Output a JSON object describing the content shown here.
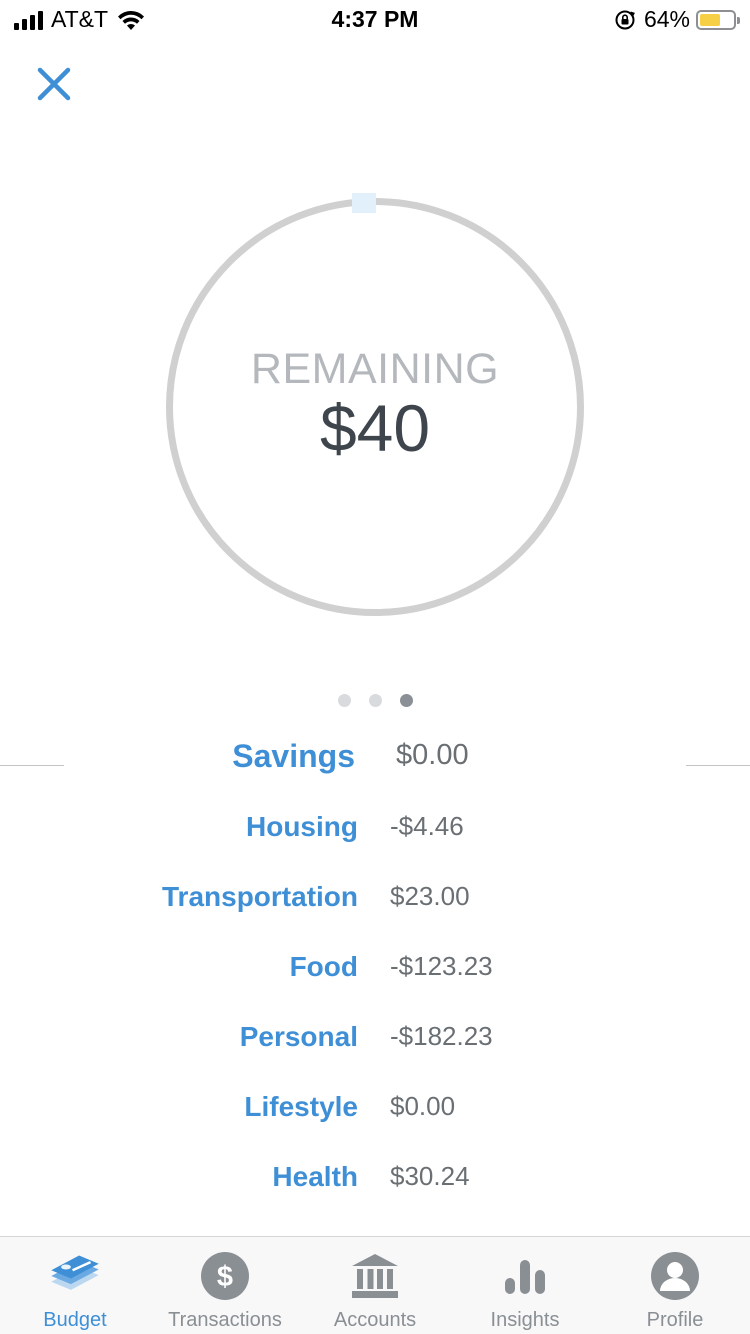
{
  "status_bar": {
    "carrier": "AT&T",
    "time": "4:37 PM",
    "battery_percent": "64%",
    "battery_level": 0.64,
    "battery_color": "#f7cf46"
  },
  "header": {
    "close_icon": "close-icon"
  },
  "summary": {
    "label": "REMAINING",
    "amount": "$40"
  },
  "pager": {
    "count": 3,
    "active_index": 2
  },
  "categories": [
    {
      "name": "Savings",
      "value": "$0.00"
    },
    {
      "name": "Housing",
      "value": "-$4.46"
    },
    {
      "name": "Transportation",
      "value": "$23.00"
    },
    {
      "name": "Food",
      "value": "-$123.23"
    },
    {
      "name": "Personal",
      "value": "-$182.23"
    },
    {
      "name": "Lifestyle",
      "value": "$0.00"
    },
    {
      "name": "Health",
      "value": "$30.24"
    }
  ],
  "tabs": [
    {
      "label": "Budget",
      "icon": "budget-stack-icon",
      "active": true
    },
    {
      "label": "Transactions",
      "icon": "dollar-icon",
      "active": false
    },
    {
      "label": "Accounts",
      "icon": "bank-icon",
      "active": false
    },
    {
      "label": "Insights",
      "icon": "bar-chart-icon",
      "active": false
    },
    {
      "label": "Profile",
      "icon": "profile-icon",
      "active": false
    }
  ],
  "colors": {
    "accent": "#3e8fd6",
    "ring": "#d0d0d0",
    "inactive_tab": "#8a8f94"
  }
}
